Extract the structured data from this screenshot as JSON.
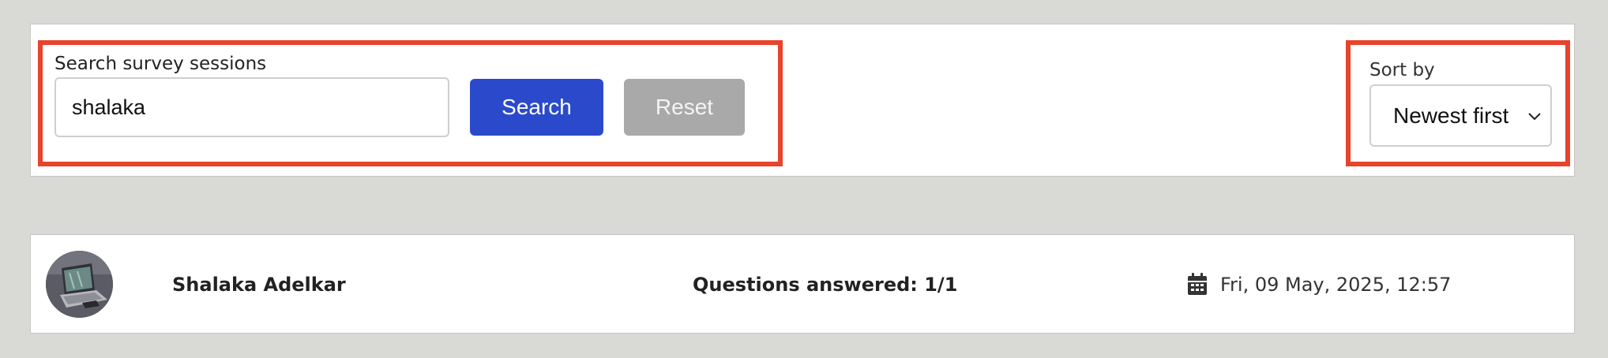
{
  "search": {
    "label": "Search survey sessions",
    "value": "shalaka",
    "search_button": "Search",
    "reset_button": "Reset"
  },
  "sort": {
    "label": "Sort by",
    "selected": "Newest first"
  },
  "colors": {
    "highlight": "#e8432b",
    "primary": "#2b4acb",
    "secondary": "#a9a9a9",
    "background": "#d9dad6"
  },
  "results": [
    {
      "name": "Shalaka Adelkar",
      "questions": "Questions answered: 1/1",
      "date": "Fri, 09 May, 2025, 12:57",
      "avatar_icon": "avatar-laptop-photo",
      "date_icon": "calendar-icon"
    }
  ]
}
